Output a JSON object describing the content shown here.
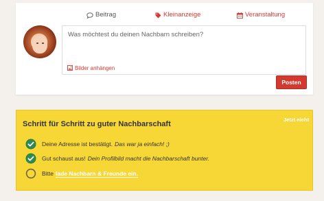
{
  "composer": {
    "tabs": [
      {
        "label": "Beitrag",
        "icon": "speech-bubble-icon"
      },
      {
        "label": "Kleinanzeige",
        "icon": "tag-icon"
      },
      {
        "label": "Veranstaltung",
        "icon": "calendar-icon"
      }
    ],
    "placeholder": "Was möchtest du deinen Nachbarn schreiben?",
    "attach_label": "Bilder anhängen",
    "attach_icon": "image-icon",
    "post_button": "Posten"
  },
  "steps": {
    "title": "Schritt für Schritt zu guter Nachbarschaft",
    "dismiss": "Jetzt nicht",
    "items": [
      {
        "text": "Deine Adresse ist bestätigt.",
        "note": "Das war ja einfach! ;)",
        "done": true
      },
      {
        "text": "Gut schaust aus!",
        "note": "Dein Profilbild macht die Nachbarschaft bunter.",
        "done": true
      },
      {
        "text": "Bitte",
        "link": "lade Nachbarn & Freunde ein.",
        "done": false
      }
    ]
  },
  "colors": {
    "accent": "#d53a33",
    "button": "#d23a2f",
    "panel": "#f7d736",
    "check": "#2e8a4e",
    "background": "#f4f1ec"
  }
}
